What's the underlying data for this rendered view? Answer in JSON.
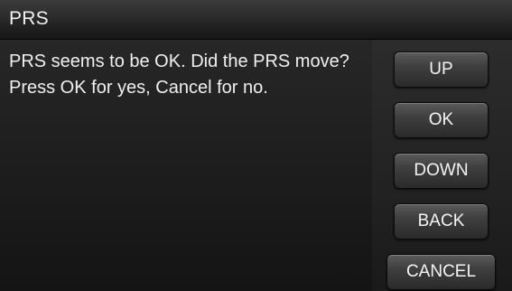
{
  "title_bar": {
    "title": "PRS"
  },
  "message": {
    "text": "PRS seems to be OK. Did the PRS move? Press OK for yes, Cancel for no."
  },
  "buttons": {
    "up": "UP",
    "ok": "OK",
    "down": "DOWN",
    "back": "BACK",
    "cancel": "CANCEL"
  }
}
